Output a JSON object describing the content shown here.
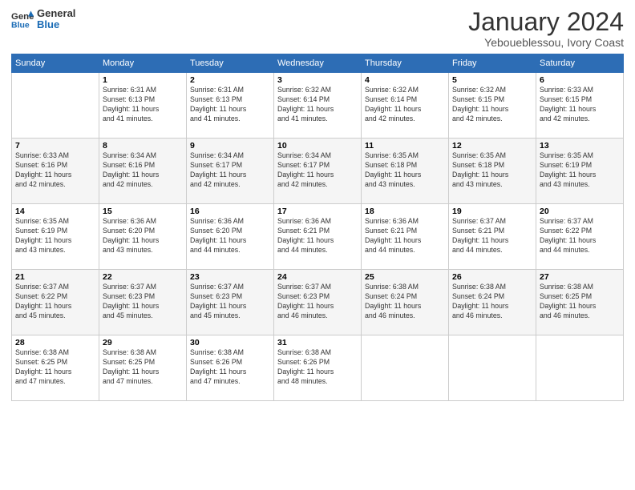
{
  "header": {
    "logo_line1": "General",
    "logo_line2": "Blue",
    "main_title": "January 2024",
    "subtitle": "Yeboueblessou, Ivory Coast"
  },
  "days_of_week": [
    "Sunday",
    "Monday",
    "Tuesday",
    "Wednesday",
    "Thursday",
    "Friday",
    "Saturday"
  ],
  "weeks": [
    [
      {
        "day": "",
        "detail": ""
      },
      {
        "day": "1",
        "detail": "Sunrise: 6:31 AM\nSunset: 6:13 PM\nDaylight: 11 hours\nand 41 minutes."
      },
      {
        "day": "2",
        "detail": "Sunrise: 6:31 AM\nSunset: 6:13 PM\nDaylight: 11 hours\nand 41 minutes."
      },
      {
        "day": "3",
        "detail": "Sunrise: 6:32 AM\nSunset: 6:14 PM\nDaylight: 11 hours\nand 41 minutes."
      },
      {
        "day": "4",
        "detail": "Sunrise: 6:32 AM\nSunset: 6:14 PM\nDaylight: 11 hours\nand 42 minutes."
      },
      {
        "day": "5",
        "detail": "Sunrise: 6:32 AM\nSunset: 6:15 PM\nDaylight: 11 hours\nand 42 minutes."
      },
      {
        "day": "6",
        "detail": "Sunrise: 6:33 AM\nSunset: 6:15 PM\nDaylight: 11 hours\nand 42 minutes."
      }
    ],
    [
      {
        "day": "7",
        "detail": "Sunrise: 6:33 AM\nSunset: 6:16 PM\nDaylight: 11 hours\nand 42 minutes."
      },
      {
        "day": "8",
        "detail": "Sunrise: 6:34 AM\nSunset: 6:16 PM\nDaylight: 11 hours\nand 42 minutes."
      },
      {
        "day": "9",
        "detail": "Sunrise: 6:34 AM\nSunset: 6:17 PM\nDaylight: 11 hours\nand 42 minutes."
      },
      {
        "day": "10",
        "detail": "Sunrise: 6:34 AM\nSunset: 6:17 PM\nDaylight: 11 hours\nand 42 minutes."
      },
      {
        "day": "11",
        "detail": "Sunrise: 6:35 AM\nSunset: 6:18 PM\nDaylight: 11 hours\nand 43 minutes."
      },
      {
        "day": "12",
        "detail": "Sunrise: 6:35 AM\nSunset: 6:18 PM\nDaylight: 11 hours\nand 43 minutes."
      },
      {
        "day": "13",
        "detail": "Sunrise: 6:35 AM\nSunset: 6:19 PM\nDaylight: 11 hours\nand 43 minutes."
      }
    ],
    [
      {
        "day": "14",
        "detail": "Sunrise: 6:35 AM\nSunset: 6:19 PM\nDaylight: 11 hours\nand 43 minutes."
      },
      {
        "day": "15",
        "detail": "Sunrise: 6:36 AM\nSunset: 6:20 PM\nDaylight: 11 hours\nand 43 minutes."
      },
      {
        "day": "16",
        "detail": "Sunrise: 6:36 AM\nSunset: 6:20 PM\nDaylight: 11 hours\nand 44 minutes."
      },
      {
        "day": "17",
        "detail": "Sunrise: 6:36 AM\nSunset: 6:21 PM\nDaylight: 11 hours\nand 44 minutes."
      },
      {
        "day": "18",
        "detail": "Sunrise: 6:36 AM\nSunset: 6:21 PM\nDaylight: 11 hours\nand 44 minutes."
      },
      {
        "day": "19",
        "detail": "Sunrise: 6:37 AM\nSunset: 6:21 PM\nDaylight: 11 hours\nand 44 minutes."
      },
      {
        "day": "20",
        "detail": "Sunrise: 6:37 AM\nSunset: 6:22 PM\nDaylight: 11 hours\nand 44 minutes."
      }
    ],
    [
      {
        "day": "21",
        "detail": "Sunrise: 6:37 AM\nSunset: 6:22 PM\nDaylight: 11 hours\nand 45 minutes."
      },
      {
        "day": "22",
        "detail": "Sunrise: 6:37 AM\nSunset: 6:23 PM\nDaylight: 11 hours\nand 45 minutes."
      },
      {
        "day": "23",
        "detail": "Sunrise: 6:37 AM\nSunset: 6:23 PM\nDaylight: 11 hours\nand 45 minutes."
      },
      {
        "day": "24",
        "detail": "Sunrise: 6:37 AM\nSunset: 6:23 PM\nDaylight: 11 hours\nand 46 minutes."
      },
      {
        "day": "25",
        "detail": "Sunrise: 6:38 AM\nSunset: 6:24 PM\nDaylight: 11 hours\nand 46 minutes."
      },
      {
        "day": "26",
        "detail": "Sunrise: 6:38 AM\nSunset: 6:24 PM\nDaylight: 11 hours\nand 46 minutes."
      },
      {
        "day": "27",
        "detail": "Sunrise: 6:38 AM\nSunset: 6:25 PM\nDaylight: 11 hours\nand 46 minutes."
      }
    ],
    [
      {
        "day": "28",
        "detail": "Sunrise: 6:38 AM\nSunset: 6:25 PM\nDaylight: 11 hours\nand 47 minutes."
      },
      {
        "day": "29",
        "detail": "Sunrise: 6:38 AM\nSunset: 6:25 PM\nDaylight: 11 hours\nand 47 minutes."
      },
      {
        "day": "30",
        "detail": "Sunrise: 6:38 AM\nSunset: 6:26 PM\nDaylight: 11 hours\nand 47 minutes."
      },
      {
        "day": "31",
        "detail": "Sunrise: 6:38 AM\nSunset: 6:26 PM\nDaylight: 11 hours\nand 48 minutes."
      },
      {
        "day": "",
        "detail": ""
      },
      {
        "day": "",
        "detail": ""
      },
      {
        "day": "",
        "detail": ""
      }
    ]
  ]
}
